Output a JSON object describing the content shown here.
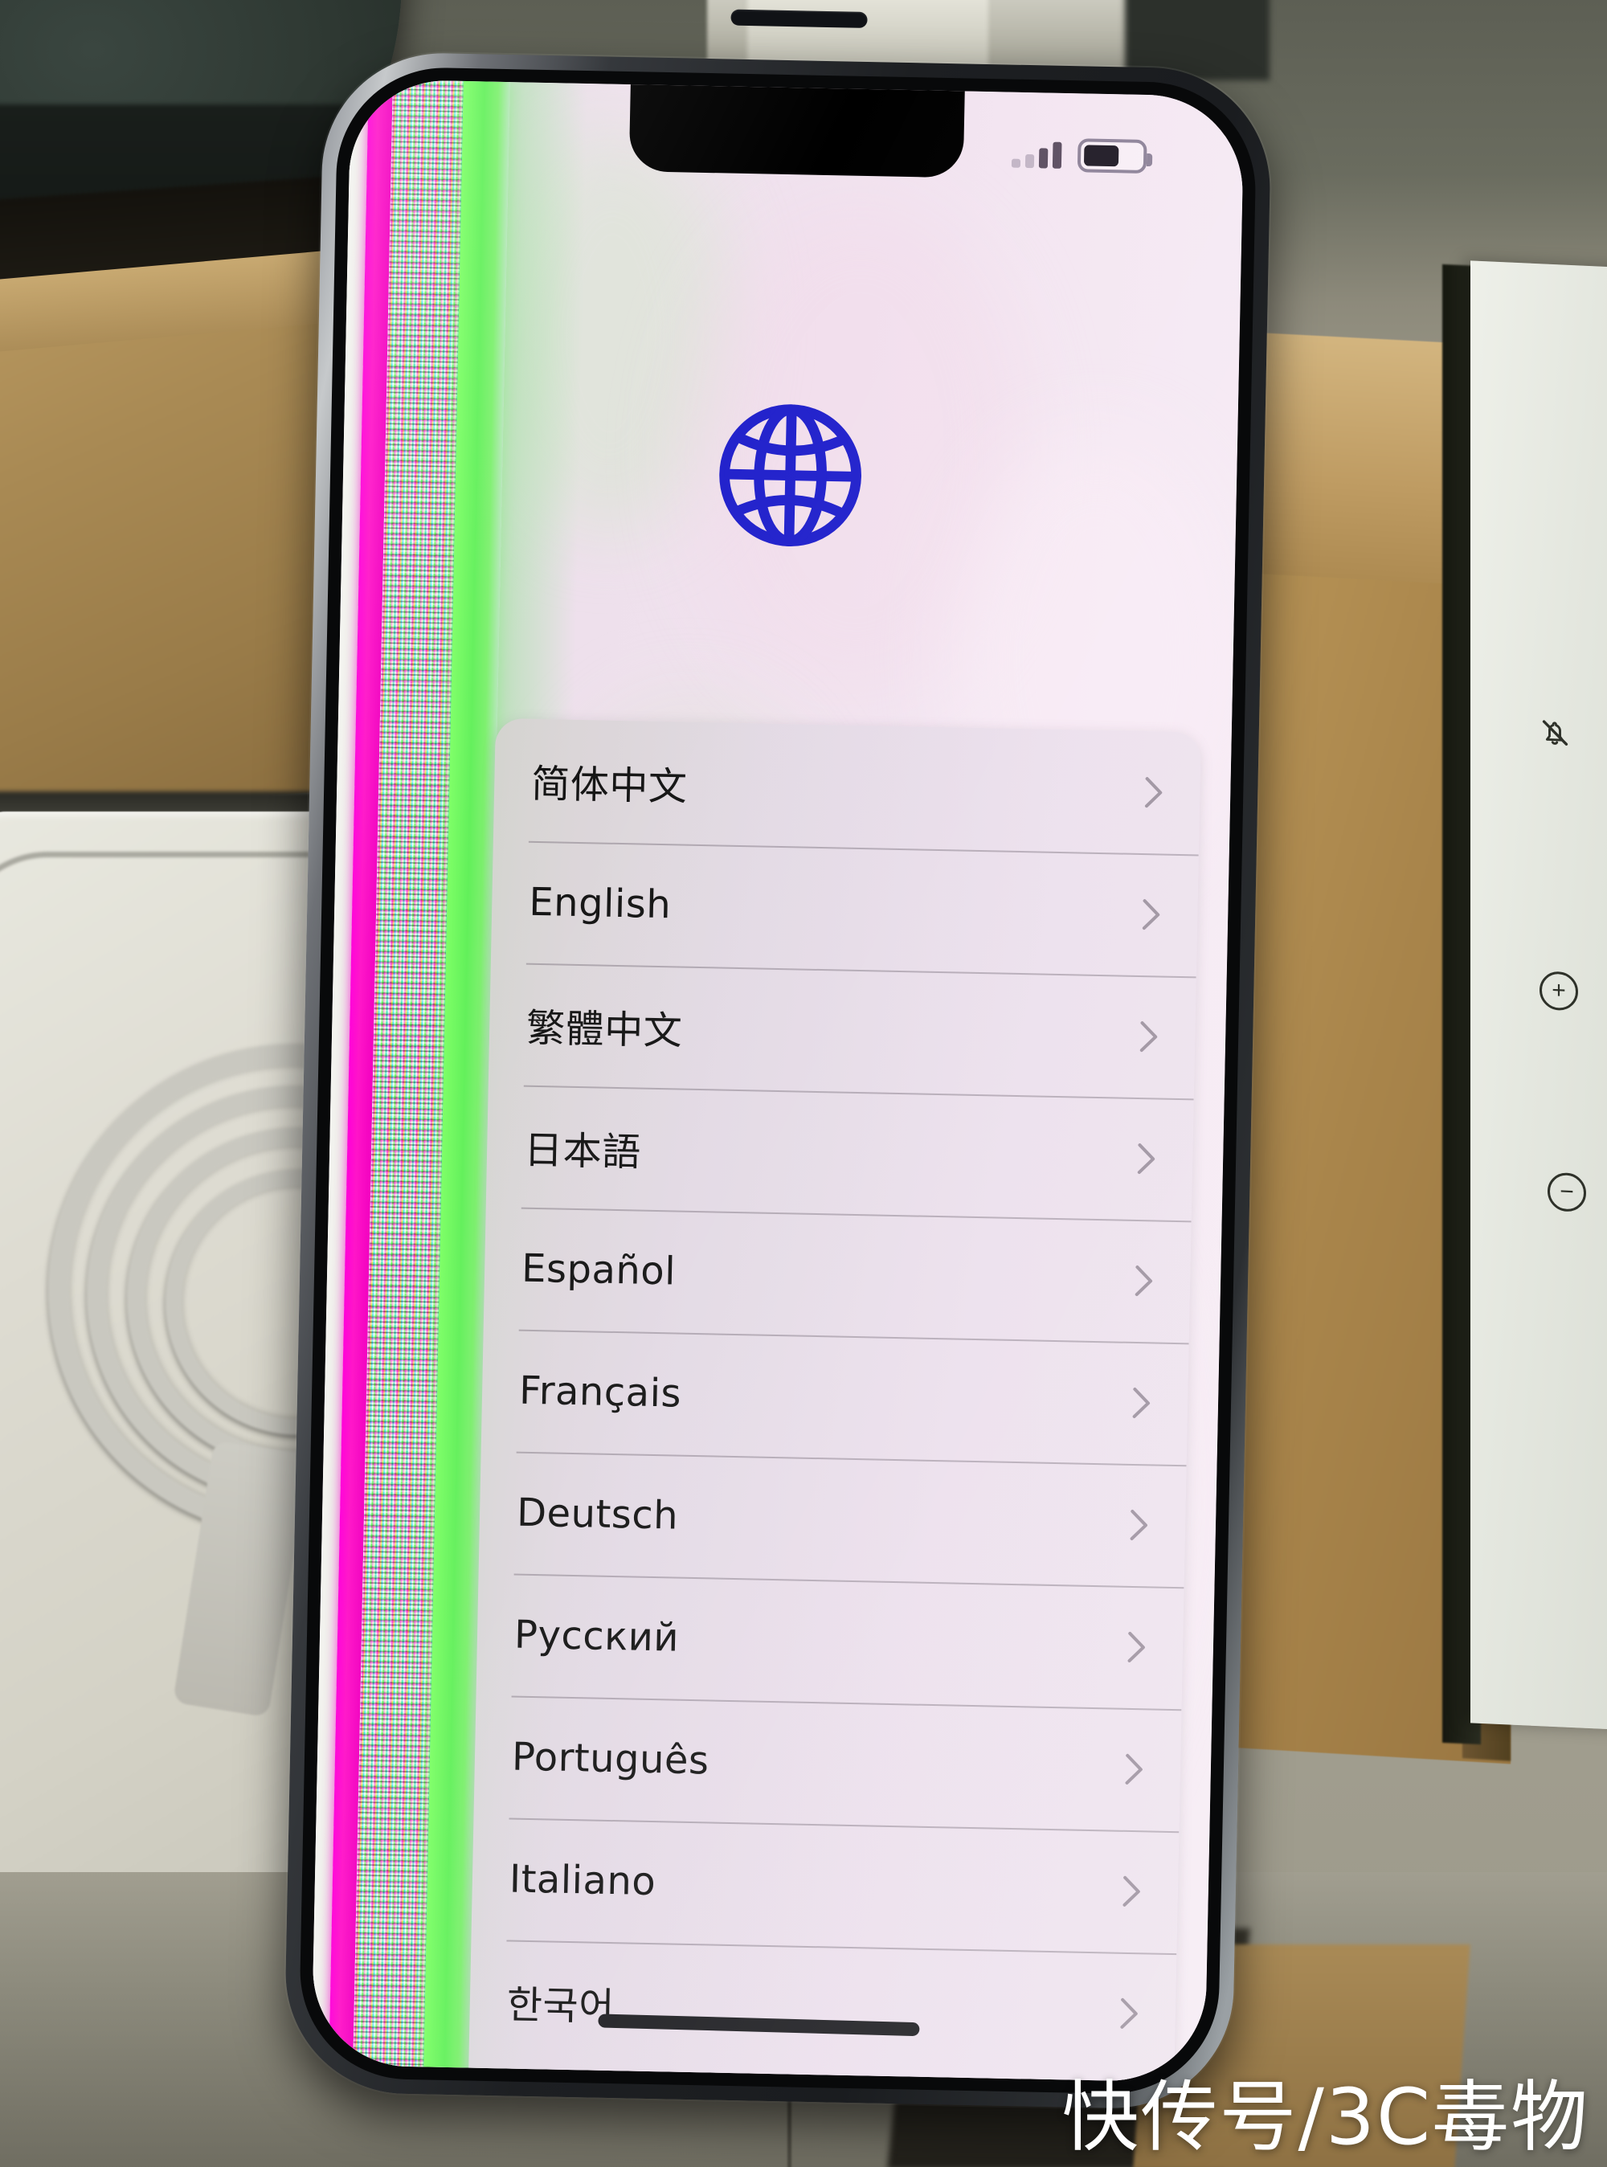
{
  "scene": {
    "description": "photo-of-iphone-with-glitched-display",
    "watermark": "快传号/3C毒物"
  },
  "phone": {
    "status_bar": {
      "signal_icon": "signal-bars-icon",
      "signal_bars_total": 4,
      "signal_bars_active": 2,
      "battery_icon": "battery-icon",
      "battery_percent": 62
    },
    "hero": {
      "icon": "globe-icon",
      "icon_color": "#2222cc"
    },
    "home_indicator": "home-indicator"
  },
  "language_list": {
    "items": [
      {
        "label": "简体中文",
        "chevron": "chevron-right-icon"
      },
      {
        "label": "English",
        "chevron": "chevron-right-icon"
      },
      {
        "label": "繁體中文",
        "chevron": "chevron-right-icon"
      },
      {
        "label": "日本語",
        "chevron": "chevron-right-icon"
      },
      {
        "label": "Español",
        "chevron": "chevron-right-icon"
      },
      {
        "label": "Français",
        "chevron": "chevron-right-icon"
      },
      {
        "label": "Deutsch",
        "chevron": "chevron-right-icon"
      },
      {
        "label": "Русский",
        "chevron": "chevron-right-icon"
      },
      {
        "label": "Português",
        "chevron": "chevron-right-icon"
      },
      {
        "label": "Italiano",
        "chevron": "chevron-right-icon"
      },
      {
        "label": "한국어",
        "chevron": "chevron-right-icon"
      }
    ]
  },
  "display_defect": {
    "type": "vertical-glitch-band",
    "colors": [
      "#ffffff",
      "#ff00d8",
      "#7dff66"
    ],
    "screen_tint": "#f2e4f0"
  },
  "background": {
    "iphone_box_icons": [
      {
        "name": "bell-slash-icon",
        "glyph": ""
      },
      {
        "name": "volume-up-icon",
        "glyph": "+"
      },
      {
        "name": "volume-down-icon",
        "glyph": "−"
      }
    ]
  }
}
